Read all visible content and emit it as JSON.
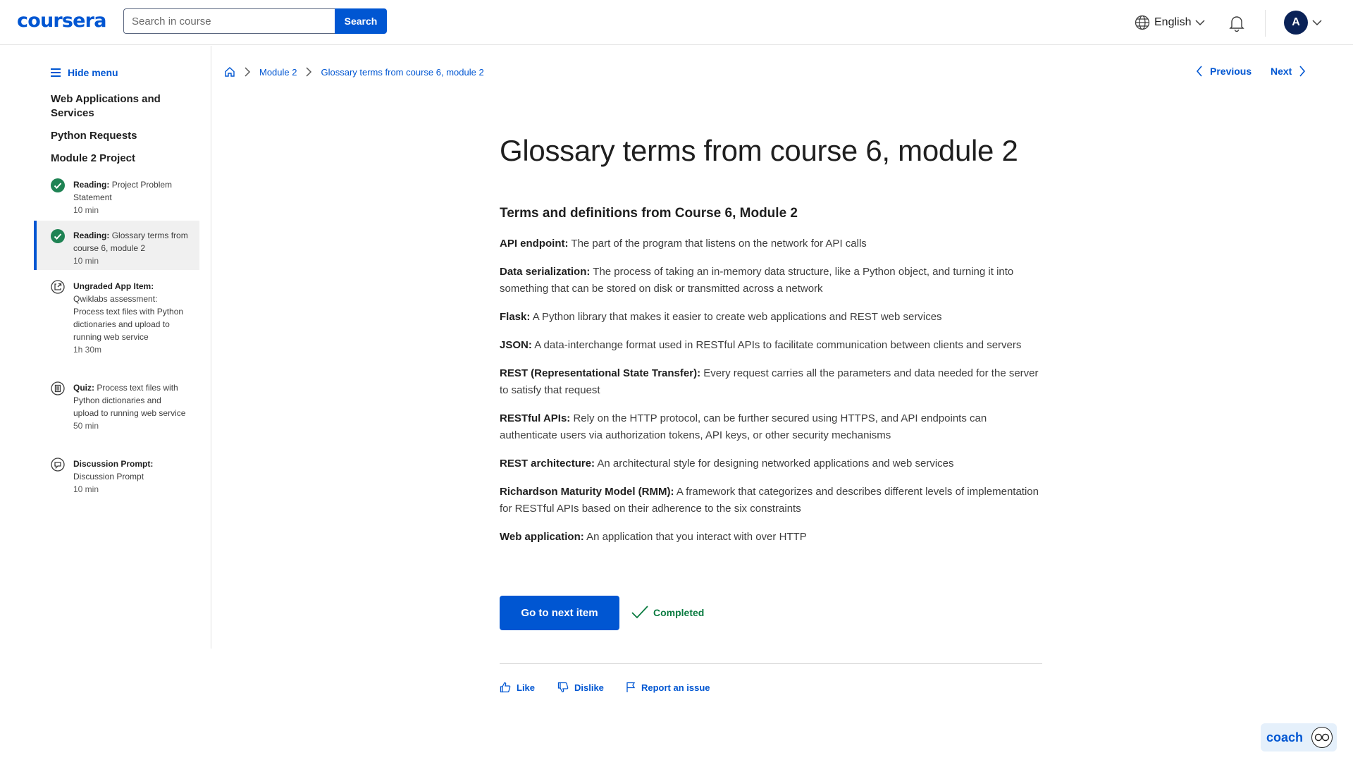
{
  "header": {
    "logo": "coursera",
    "search_placeholder": "Search in course",
    "search_button": "Search",
    "language": "English",
    "avatar_initial": "A"
  },
  "sidebar": {
    "hide_menu": "Hide menu",
    "sections": [
      "Web Applications and Services",
      "Python Requests",
      "Module 2 Project"
    ],
    "items": [
      {
        "type": "Reading:",
        "title": "Project Problem Statement",
        "duration": "10 min",
        "status": "completed"
      },
      {
        "type": "Reading:",
        "title": "Glossary terms from course 6, module 2",
        "duration": "10 min",
        "status": "completed",
        "active": true
      },
      {
        "type": "Ungraded App Item:",
        "title": "Qwiklabs assessment: Process text files with Python dictionaries and upload to running web service",
        "duration": "1h 30m",
        "status": "app"
      },
      {
        "type": "Quiz:",
        "title": "Process text files with Python dictionaries and upload to running web service",
        "duration": "50 min",
        "status": "quiz"
      },
      {
        "type": "Discussion Prompt:",
        "title": "Discussion Prompt",
        "duration": "10 min",
        "status": "discussion"
      }
    ]
  },
  "breadcrumb": {
    "module": "Module 2",
    "current": "Glossary terms from course 6, module 2"
  },
  "nav": {
    "previous": "Previous",
    "next": "Next"
  },
  "main": {
    "title": "Glossary terms from course 6, module 2",
    "subheading": "Terms and definitions from Course 6, Module 2",
    "terms": [
      {
        "term": "API endpoint:",
        "definition": "The part of the program that listens on the network for API calls"
      },
      {
        "term": "Data serialization:",
        "definition": "The process of taking an in-memory data structure, like a Python object, and turning it into something that can be stored on disk or transmitted across a network"
      },
      {
        "term": "Flask:",
        "definition": "A Python library that makes it easier to create web applications and REST web services"
      },
      {
        "term": "JSON:",
        "definition": "A data-interchange format used in RESTful APIs to facilitate communication between clients and servers"
      },
      {
        "term": "REST (Representational State Transfer):",
        "definition": "Every request carries all the parameters and data needed for the server to satisfy that request"
      },
      {
        "term": "RESTful APIs:",
        "definition": "Rely on the HTTP protocol, can be further secured using HTTPS, and API endpoints can authenticate users via authorization tokens, API keys, or other security mechanisms"
      },
      {
        "term": "REST architecture:",
        "definition": "An architectural style for designing networked applications and web services"
      },
      {
        "term": "Richardson Maturity Model (RMM):",
        "definition": "A framework that categorizes and describes different levels of implementation for RESTful APIs based on their adherence to the six constraints"
      },
      {
        "term": "Web application:",
        "definition": "An application that you interact with over HTTP"
      }
    ],
    "next_button": "Go to next item",
    "completed_label": "Completed"
  },
  "feedback": {
    "like": "Like",
    "dislike": "Dislike",
    "report": "Report an issue"
  },
  "coach": {
    "label": "coach"
  },
  "colors": {
    "brand": "#0056d2",
    "success": "#0a7b40"
  }
}
